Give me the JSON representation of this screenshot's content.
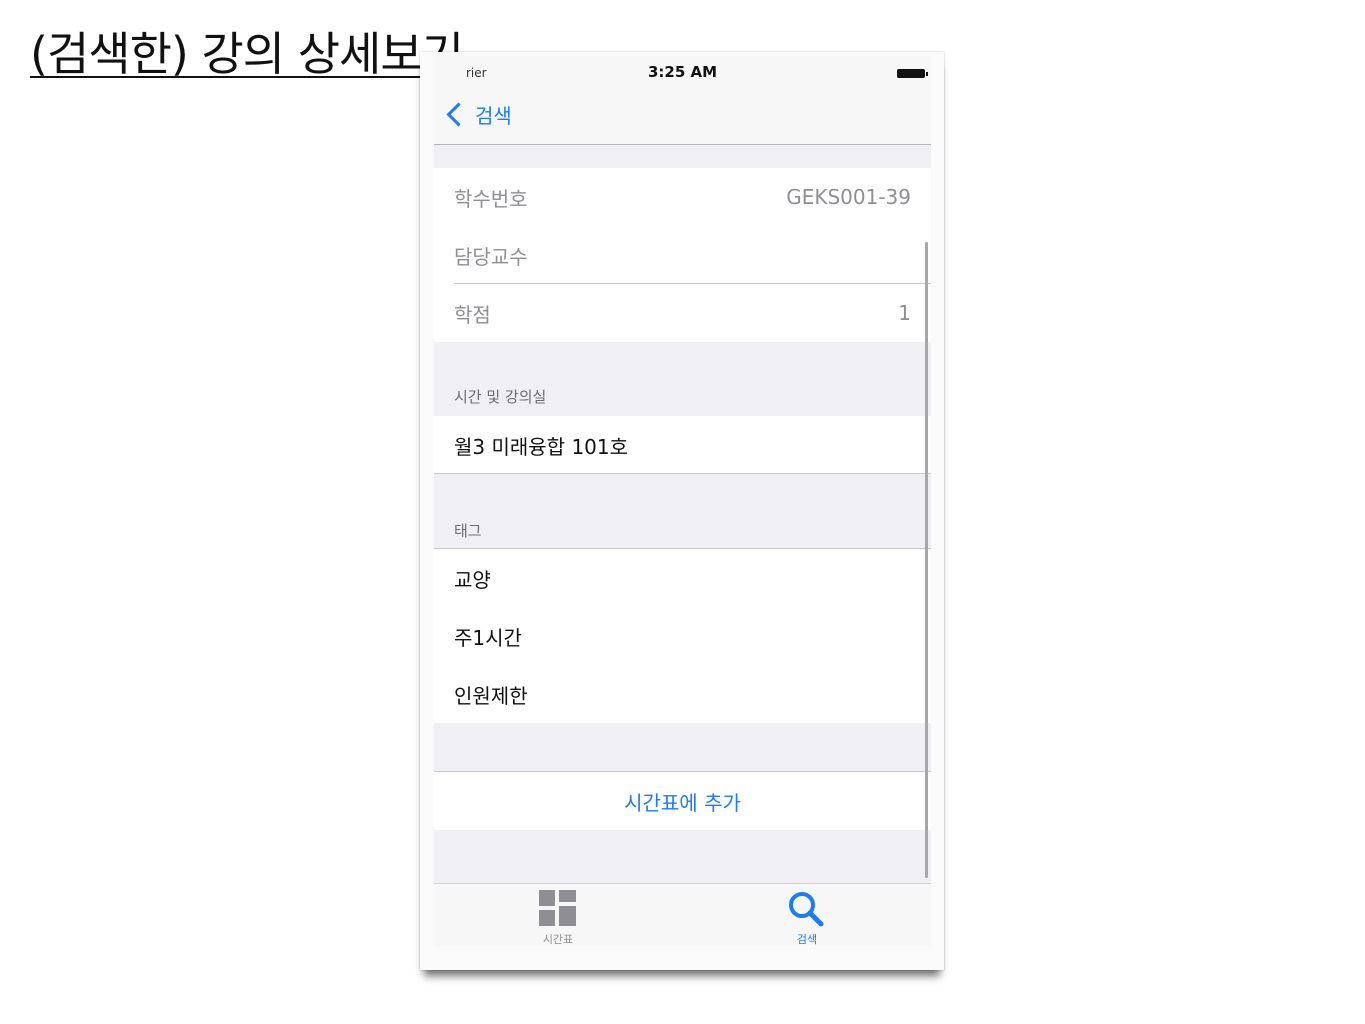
{
  "slide": {
    "title": "(검색한) 강의 상세보기"
  },
  "status_bar": {
    "carrier": "rier",
    "time": "3:25 AM"
  },
  "nav": {
    "back_label": "검색"
  },
  "info": {
    "rows": [
      {
        "key": "학수번호",
        "value": "GEKS001-39"
      },
      {
        "key": "담당교수",
        "value": ""
      },
      {
        "key": "학점",
        "value": "1"
      }
    ]
  },
  "schedule": {
    "header": "시간 및 강의실",
    "items": [
      "월3 미래융합 101호"
    ]
  },
  "tags": {
    "header": "태그",
    "items": [
      "교양",
      "주1시간",
      "인원제한"
    ]
  },
  "action": {
    "add_label": "시간표에 추가"
  },
  "tab_bar": {
    "tabs": [
      {
        "label": "시간표",
        "icon": "grid-icon",
        "active": false
      },
      {
        "label": "검색",
        "icon": "search-icon",
        "active": true
      }
    ]
  },
  "colors": {
    "accent": "#1b7cf5",
    "background": "#efeff4",
    "secondary_text": "#8e8e93"
  }
}
